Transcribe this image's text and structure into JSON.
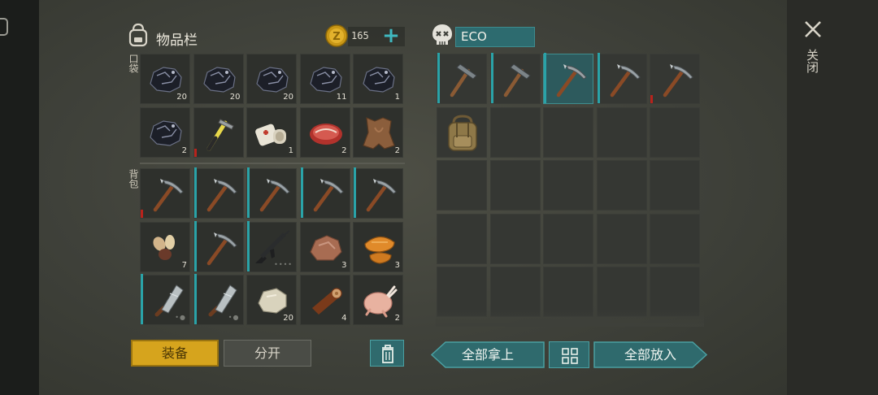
{
  "header": {
    "inventory_title": "物品栏",
    "coins": "165",
    "chest_name": "ECO",
    "close_label": "关闭",
    "add_coin_symbol": "+"
  },
  "sections": {
    "pocket_label": "口袋",
    "backpack_label": "背包"
  },
  "pocket": [
    {
      "item": "coal",
      "qty": "20"
    },
    {
      "item": "coal",
      "qty": "20"
    },
    {
      "item": "coal",
      "qty": "20"
    },
    {
      "item": "coal",
      "qty": "11"
    },
    {
      "item": "coal",
      "qty": "1"
    },
    {
      "item": "coal",
      "qty": "2"
    },
    {
      "item": "hammer",
      "qty": "",
      "durability": "red"
    },
    {
      "item": "bandage",
      "qty": "1"
    },
    {
      "item": "raw-meat",
      "qty": "2"
    },
    {
      "item": "leather",
      "qty": "2"
    }
  ],
  "backpack": [
    {
      "item": "pickaxe",
      "qty": "",
      "durability": "red"
    },
    {
      "item": "pickaxe",
      "qty": "",
      "durability": "teal"
    },
    {
      "item": "pickaxe",
      "qty": "",
      "durability": "teal"
    },
    {
      "item": "pickaxe",
      "qty": "",
      "durability": "teal"
    },
    {
      "item": "pickaxe",
      "qty": "",
      "durability": "teal"
    },
    {
      "item": "seeds",
      "qty": "7"
    },
    {
      "item": "pickaxe",
      "qty": "",
      "durability": "teal"
    },
    {
      "item": "rifle",
      "qty": "",
      "durability": "teal",
      "ammo_dots": "••••"
    },
    {
      "item": "ore-rock",
      "qty": "3"
    },
    {
      "item": "mushroom-flat",
      "qty": "3"
    },
    {
      "item": "cleaver",
      "qty": "",
      "durability": "teal",
      "ammo_dots": "•●"
    },
    {
      "item": "cleaver",
      "qty": "",
      "durability": "teal",
      "ammo_dots": "•●"
    },
    {
      "item": "stone",
      "qty": "20"
    },
    {
      "item": "wood-log",
      "qty": "4"
    },
    {
      "item": "raw-chicken",
      "qty": "2"
    }
  ],
  "chest": [
    {
      "item": "hammer-tool",
      "durability": "teal"
    },
    {
      "item": "hammer-tool",
      "durability": "teal"
    },
    {
      "item": "pickaxe",
      "durability": "teal",
      "selected": true
    },
    {
      "item": "pickaxe",
      "durability": "teal"
    },
    {
      "item": "pickaxe",
      "durability": "red"
    },
    {
      "item": "backpack"
    }
  ],
  "buttons": {
    "equip": "装备",
    "split": "分开",
    "take_all": "全部拿上",
    "put_all": "全部放入"
  },
  "colors": {
    "accent_teal": "#2f6a6d",
    "equip_gold": "#d6a41d",
    "durability_red": "#b8231c",
    "durability_teal": "#2aa3a8"
  }
}
